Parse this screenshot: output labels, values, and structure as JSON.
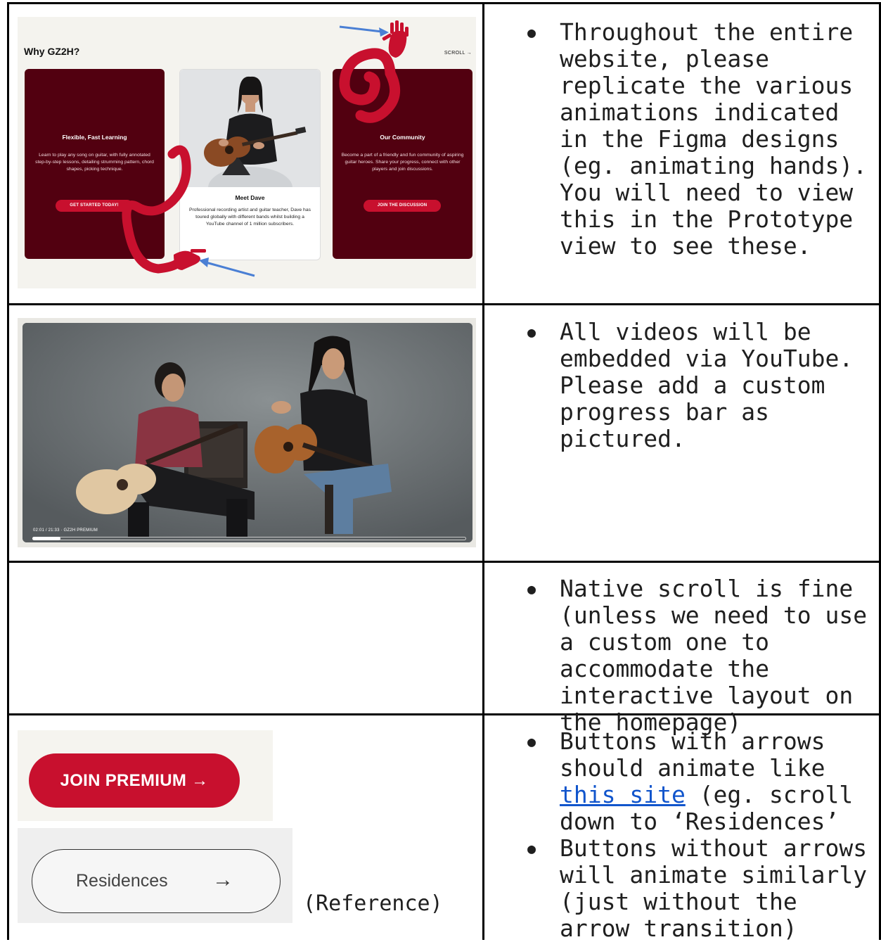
{
  "rows": [
    {
      "notes": [
        "Throughout the entire website, please replicate the various animations indicated in the Figma designs (eg. animating hands). You will need to view this in the Prototype view to see these."
      ]
    },
    {
      "notes": [
        "All videos will be embedded via YouTube. Please add a custom progress bar as pictured."
      ]
    },
    {
      "notes": [
        "Native scroll is fine (unless we need to use a custom one to accommodate the interactive layout on the homepage)"
      ]
    },
    {
      "notes_parts": {
        "b1_pre": "Buttons with arrows should animate like ",
        "b1_link": "this site",
        "b1_post": " (eg. scroll down to ‘Residences’",
        "b2": "Buttons without arrows will animate similarly (just without the arrow transition)"
      },
      "reference_label": "(Reference)"
    }
  ],
  "site": {
    "title": "Why GZ2H?",
    "scroll_label": "SCROLL →",
    "cards": {
      "left": {
        "heading": "Flexible, Fast Learning",
        "body": "Learn to play any song on guitar, with fully annotated step-by-step lessons, detailing strumming pattern, chord shapes, picking technique.",
        "button": "GET STARTED TODAY!"
      },
      "center": {
        "heading": "Meet Dave",
        "body": "Professional recording artist and guitar teacher, Dave has toured globally with different bands whilst building a YouTube channel of 1 million subscribers."
      },
      "right": {
        "heading": "Our Community",
        "body": "Become a part of a friendly and fun community of aspiring guitar heroes. Share your progress, connect with other players and join discussions.",
        "button": "JOIN THE DISCUSSION"
      }
    }
  },
  "video": {
    "time_label": "02:01 / 21:33 · GZ2H PREMIUM",
    "progress": 0.065
  },
  "buttons": {
    "join": "JOIN PREMIUM →",
    "residences": "Residences",
    "residences_arrow": "→"
  },
  "colors": {
    "brand_red": "#c8102e",
    "card_maroon": "#520010",
    "arrow_blue": "#4a7fd4"
  }
}
